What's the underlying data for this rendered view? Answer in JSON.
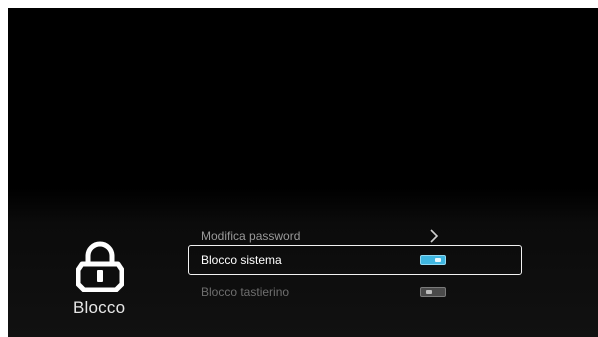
{
  "section": {
    "title": "Blocco",
    "icon": "lock-icon"
  },
  "menu": {
    "items": [
      {
        "label": "Modifica password",
        "control": "chevron-right-icon"
      },
      {
        "label": "Blocco sistema",
        "control": "toggle",
        "state": "on",
        "selected": true
      },
      {
        "label": "Blocco tastierino",
        "control": "toggle",
        "state": "off"
      }
    ]
  },
  "colors": {
    "background": "#000000",
    "toggle_on": "#3fb6e0",
    "toggle_off": "#4a4a4a",
    "selection_border": "#f2f2f2"
  }
}
